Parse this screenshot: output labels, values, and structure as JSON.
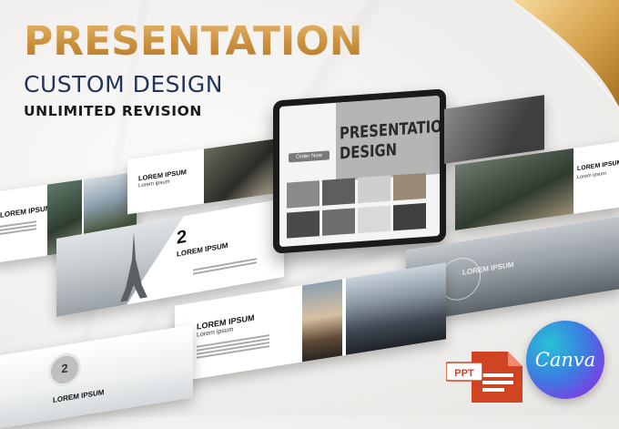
{
  "headline": {
    "title": "PRESENTATION",
    "subtitle": "CUSTOM DESIGN",
    "tagline": "UNLIMITED REVISION"
  },
  "tablet": {
    "heading_line1": "PRESENTATION",
    "heading_line2": "DESIGN",
    "order_button": "Order Now"
  },
  "slides": {
    "lorem": "LOREM IPSUM",
    "lorem_sub": "Lorem ipsum",
    "number_2": "2",
    "number_2b": "2"
  },
  "badges": {
    "ppt_label": "PPT",
    "canva_label": "Canva",
    "ppt_icon": "ppt-file-icon",
    "canva_icon": "canva-logo-icon"
  },
  "colors": {
    "gold": "#c98f3a",
    "navy": "#23355c",
    "ppt_red": "#d04423",
    "canva_blue": "#3b7ee0"
  }
}
